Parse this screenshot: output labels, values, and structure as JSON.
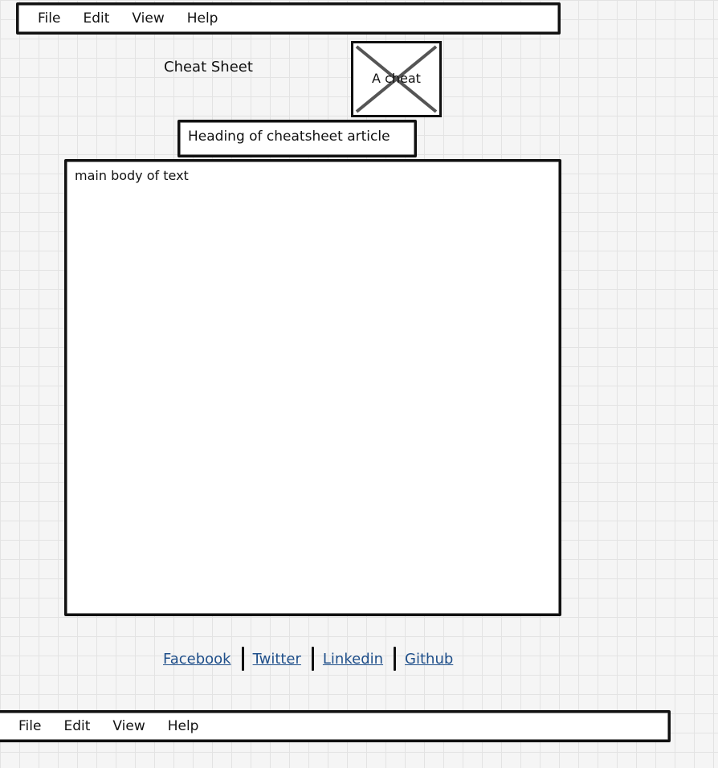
{
  "menubar_top": {
    "items": [
      "File",
      "Edit",
      "View",
      "Help"
    ]
  },
  "header": {
    "site_title": "Cheat Sheet",
    "logo_placeholder_text": "A cheat"
  },
  "article": {
    "heading": "Heading of cheatsheet article",
    "body_text": "main body of text"
  },
  "footer": {
    "links": [
      "Facebook",
      "Twitter",
      "Linkedin",
      "Github"
    ]
  },
  "menubar_bottom": {
    "items": [
      "File",
      "Edit",
      "View",
      "Help"
    ]
  },
  "colors": {
    "link": "#1f4f8a",
    "border": "#111111",
    "grid": "#e3e3e3",
    "background": "#f5f5f5"
  }
}
